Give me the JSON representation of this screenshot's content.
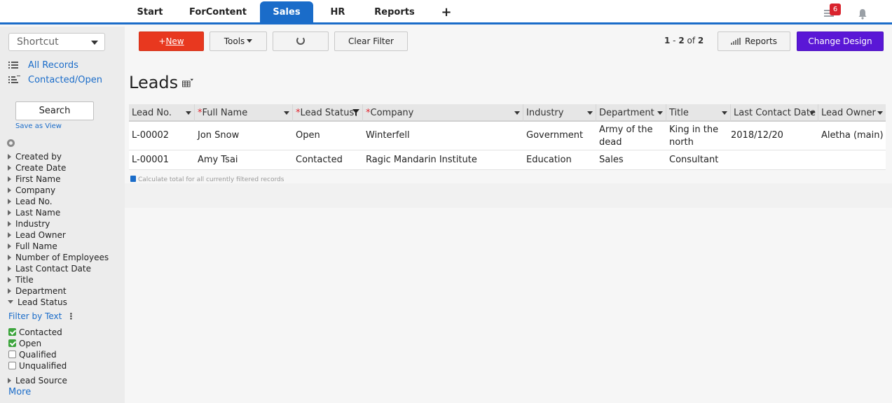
{
  "topbar": {
    "tabs": [
      {
        "label": "Start",
        "active": false
      },
      {
        "label": "ForContent",
        "active": false
      },
      {
        "label": "Sales",
        "active": true
      },
      {
        "label": "HR",
        "active": false
      },
      {
        "label": "Reports",
        "active": false
      }
    ],
    "add_label": "+",
    "task_badge": "6"
  },
  "sidebar": {
    "shortcut_label": "Shortcut",
    "links": [
      {
        "label": "All Records"
      },
      {
        "label": "Contacted/Open"
      }
    ],
    "search_label": "Search",
    "save_as_view": "Save as View",
    "fields": [
      "Created by",
      "Create Date",
      "First Name",
      "Company",
      "Lead No.",
      "Last Name",
      "Industry",
      "Lead Owner",
      "Full Name",
      "Number of Employees",
      "Last Contact Date",
      "Title",
      "Department"
    ],
    "expanded_field": "Lead Status",
    "filter_by_text": "Filter by Text",
    "filter_options": [
      {
        "label": "Contacted",
        "checked": true
      },
      {
        "label": "Open",
        "checked": true
      },
      {
        "label": "Qualified",
        "checked": false
      },
      {
        "label": "Unqualified",
        "checked": false
      }
    ],
    "lead_source": "Lead Source",
    "more": "More"
  },
  "toolbar": {
    "new_plus": "+",
    "new_label": "New",
    "tools_label": "Tools",
    "clear_filter_label": "Clear Filter",
    "pager": {
      "from": "1",
      "sep": " - ",
      "to": "2",
      "of": " of ",
      "total": "2"
    },
    "reports_label": "Reports",
    "change_design_label": "Change Design"
  },
  "page_title": "Leads",
  "table": {
    "columns": [
      {
        "label": "Lead No.",
        "required": false
      },
      {
        "label": "Full Name",
        "required": true
      },
      {
        "label": "Lead Status",
        "required": true
      },
      {
        "label": "Company",
        "required": true
      },
      {
        "label": "Industry",
        "required": false
      },
      {
        "label": "Department",
        "required": false
      },
      {
        "label": "Title",
        "required": false
      },
      {
        "label": "Last Contact Date",
        "required": false
      },
      {
        "label": "Lead Owner",
        "required": false
      }
    ],
    "rows": [
      {
        "lead_no": "L-00002",
        "full_name": "Jon Snow",
        "lead_status": "Open",
        "company": "Winterfell",
        "industry": "Government",
        "department": "Army of the dead",
        "title": "King in the north",
        "last_contact": "2018/12/20",
        "lead_owner": "Aletha (main)"
      },
      {
        "lead_no": "L-00001",
        "full_name": "Amy Tsai",
        "lead_status": "Contacted",
        "company": "Ragic Mandarin Institute",
        "industry": "Education",
        "department": "Sales",
        "title": "Consultant",
        "last_contact": "",
        "lead_owner": ""
      }
    ],
    "calc_note": "Calculate total for all currently filtered records"
  }
}
